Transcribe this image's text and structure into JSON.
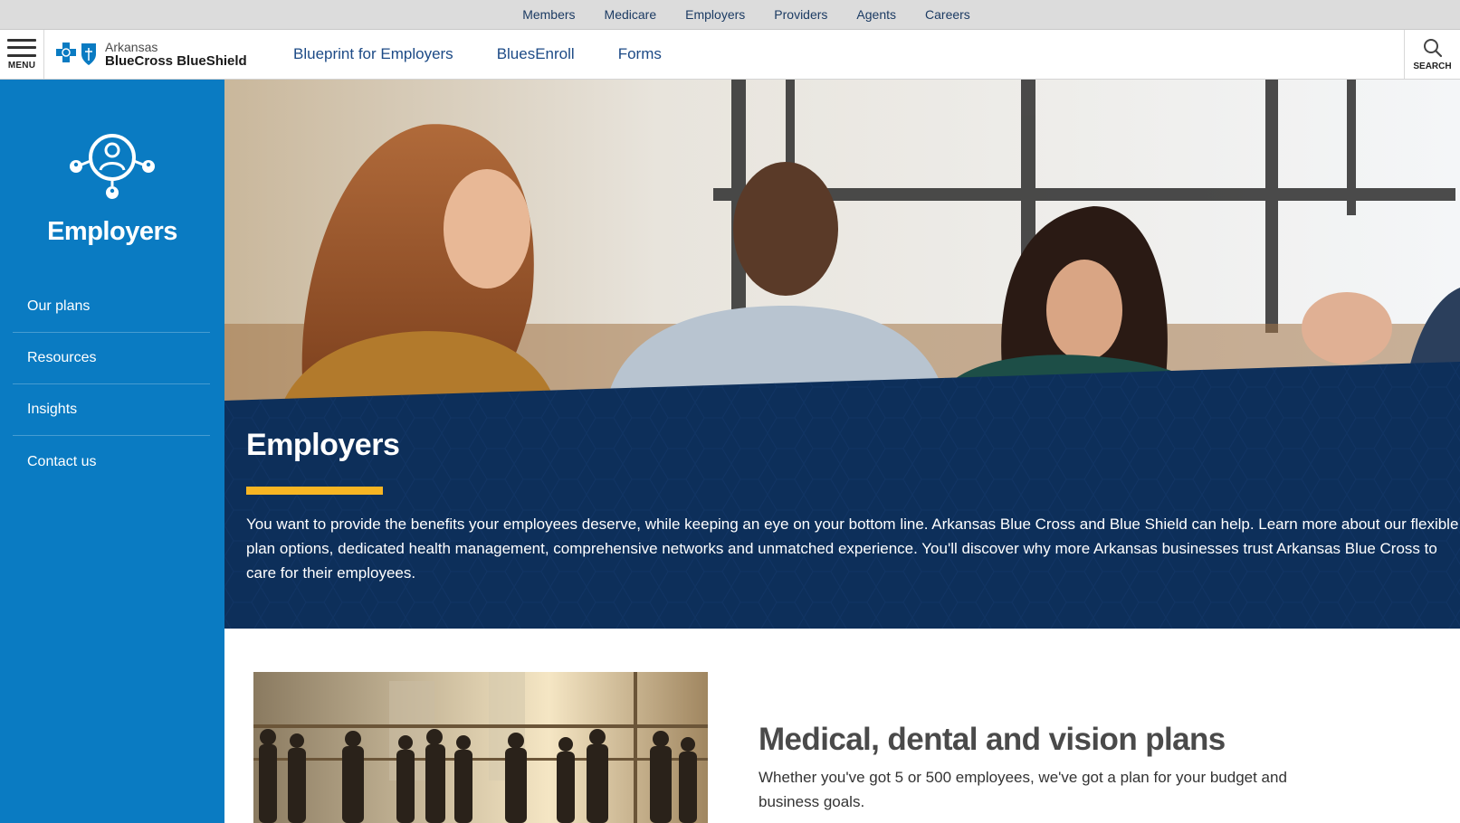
{
  "utility_nav": {
    "items": [
      "Members",
      "Medicare",
      "Employers",
      "Providers",
      "Agents",
      "Careers"
    ]
  },
  "header": {
    "menu_label": "MENU",
    "logo": {
      "line1": "Arkansas",
      "line2": "BlueCross BlueShield"
    },
    "nav": [
      "Blueprint for Employers",
      "BluesEnroll",
      "Forms"
    ],
    "search_label": "SEARCH"
  },
  "sidebar": {
    "icon": "network-people-icon",
    "title": "Employers",
    "items": [
      "Our plans",
      "Resources",
      "Insights",
      "Contact us"
    ]
  },
  "hero": {
    "title": "Employers",
    "body": "You want to provide the benefits your employees deserve, while keeping an eye on your bottom line. Arkansas Blue Cross and Blue Shield can help. Learn more about our flexible plan options, dedicated health management, comprehensive networks and unmatched experience. You'll discover why more Arkansas businesses trust Arkansas Blue Cross to care for their employees."
  },
  "plans_section": {
    "title": "Medical, dental and vision plans",
    "body": "Whether you've got 5 or 500 employees, we've got a plan for your budget and business goals."
  },
  "colors": {
    "sidebar_blue": "#0a7bc2",
    "hero_navy": "#0d2f5a",
    "accent_gold": "#f7b523",
    "nav_blue": "#1c4a86"
  }
}
